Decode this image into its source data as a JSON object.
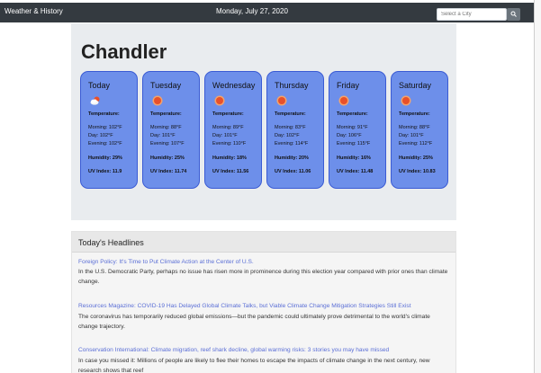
{
  "navbar": {
    "brand": "Weather & History",
    "date": "Monday, July 27, 2020",
    "search_placeholder": "Select a City",
    "search_icon": "search-icon"
  },
  "weather": {
    "city": "Chandler",
    "temperature_label": "Temperature:",
    "days": [
      {
        "name": "Today",
        "icon": "partly-cloudy-icon",
        "morning": "Morning: 102°F",
        "day": "Day: 102°F",
        "evening": "Evening: 102°F",
        "humidity": "Humidity: 29%",
        "uv": "UV Index: 11.9"
      },
      {
        "name": "Tuesday",
        "icon": "sun-icon",
        "morning": "Morning: 88°F",
        "day": "Day: 101°F",
        "evening": "Evening: 107°F",
        "humidity": "Humidity: 25%",
        "uv": "UV Index: 11.74"
      },
      {
        "name": "Wednesday",
        "icon": "sun-icon",
        "morning": "Morning: 89°F",
        "day": "Day: 101°F",
        "evening": "Evening: 110°F",
        "humidity": "Humidity: 18%",
        "uv": "UV Index: 11.56"
      },
      {
        "name": "Thursday",
        "icon": "sun-icon",
        "morning": "Morning: 83°F",
        "day": "Day: 102°F",
        "evening": "Evening: 114°F",
        "humidity": "Humidity: 20%",
        "uv": "UV Index: 11.06"
      },
      {
        "name": "Friday",
        "icon": "sun-icon",
        "morning": "Morning: 91°F",
        "day": "Day: 106°F",
        "evening": "Evening: 115°F",
        "humidity": "Humidity: 16%",
        "uv": "UV Index: 11.48"
      },
      {
        "name": "Saturday",
        "icon": "sun-icon",
        "morning": "Morning: 88°F",
        "day": "Day: 101°F",
        "evening": "Evening: 112°F",
        "humidity": "Humidity: 25%",
        "uv": "UV Index: 10.83"
      }
    ]
  },
  "headlines": {
    "title": "Today's Headlines",
    "articles": [
      {
        "link": "Foreign Policy: It's Time to Put Climate Action at the Center of U.S.",
        "summary": "In the U.S. Democratic Party, perhaps no issue has risen more in prominence during this election year compared with prior ones than climate change."
      },
      {
        "link": "Resources Magazine: COVID-19 Has Delayed Global Climate Talks, but Viable Climate Change Mitigation Strategies Still Exist",
        "summary": "The coronavirus has temporarily reduced global emissions—but the pandemic could ultimately prove detrimental to the world's climate change trajectory."
      },
      {
        "link": "Conservation International: Climate migration, reef shark decline, global warming risks: 3 stories you may have missed",
        "summary": "In case you missed it: Millions of people are likely to flee their homes to escape the impacts of climate change in the next century, new research shows that reef"
      }
    ]
  },
  "colors": {
    "navbar": "#343a40",
    "card_background": "#6d8fea",
    "card_border": "#3a5bd4",
    "panel_background": "#e9ecef",
    "link": "#5b6fd6"
  }
}
